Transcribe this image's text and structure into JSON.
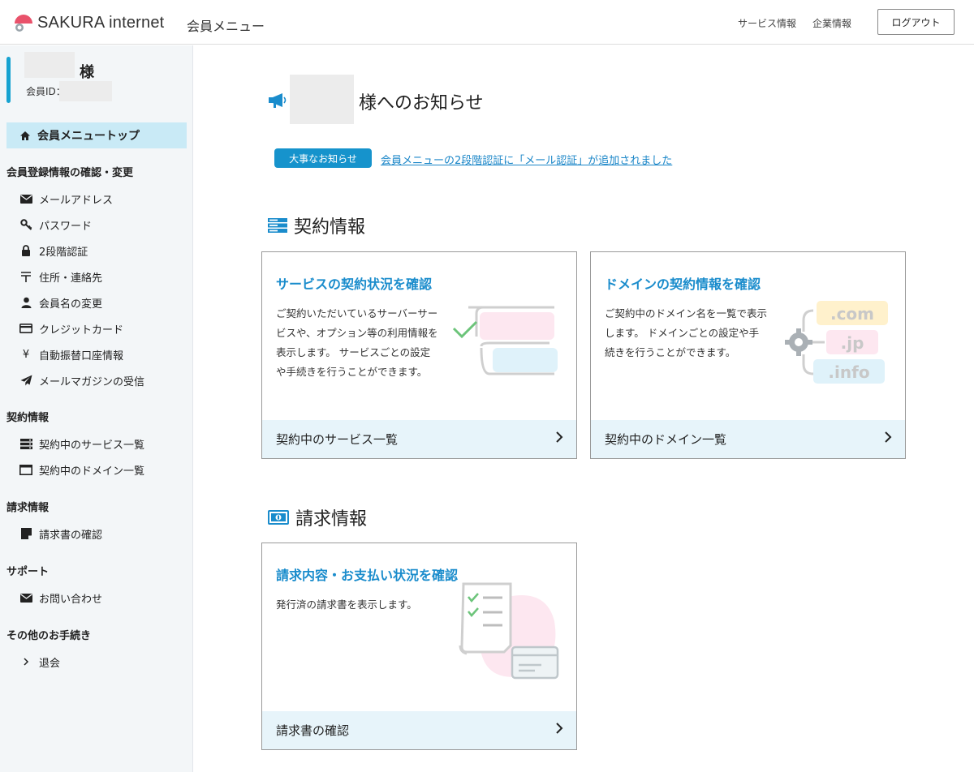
{
  "header": {
    "brand": "SAKURA internet",
    "title": "会員メニュー",
    "links": [
      "サービス情報",
      "企業情報"
    ],
    "logout_label": "ログアウト"
  },
  "sidebar": {
    "user_suffix": "様",
    "member_id_label": "会員ID：",
    "top_item": "会員メニュートップ",
    "sections": [
      {
        "title": "会員登録情報の確認・変更",
        "items": [
          {
            "label": "メールアドレス",
            "icon": "envelope-icon"
          },
          {
            "label": "パスワード",
            "icon": "key-icon"
          },
          {
            "label": "2段階認証",
            "icon": "lock-icon"
          },
          {
            "label": "住所・連絡先",
            "icon": "postal-mark-icon"
          },
          {
            "label": "会員名の変更",
            "icon": "user-icon"
          },
          {
            "label": "クレジットカード",
            "icon": "credit-card-icon"
          },
          {
            "label": "自動振替口座情報",
            "icon": "yen-icon"
          },
          {
            "label": "メールマガジンの受信",
            "icon": "paper-plane-icon"
          }
        ]
      },
      {
        "title": "契約情報",
        "items": [
          {
            "label": "契約中のサービス一覧",
            "icon": "server-icon"
          },
          {
            "label": "契約中のドメイン一覧",
            "icon": "window-icon"
          }
        ]
      },
      {
        "title": "請求情報",
        "items": [
          {
            "label": "請求書の確認",
            "icon": "note-icon"
          }
        ]
      },
      {
        "title": "サポート",
        "items": [
          {
            "label": "お問い合わせ",
            "icon": "envelope-icon"
          }
        ]
      },
      {
        "title": "その他のお手続き",
        "items": [
          {
            "label": "退会",
            "icon": "chevron-right-icon"
          }
        ]
      }
    ]
  },
  "main": {
    "notice_suffix": "様へのお知らせ",
    "badge": "大事なお知らせ",
    "notice_link": "会員メニューの2段階認証に「メール認証」が追加されました",
    "contract_title": "契約情報",
    "billing_title": "請求情報",
    "cards": [
      {
        "title": "サービスの契約状況を確認",
        "desc": "ご契約いただいているサーバーサービスや、オプション等の利用情報を表示します。 サービスごとの設定や手続きを行うことができます。",
        "footer": "契約中のサービス一覧"
      },
      {
        "title": "ドメインの契約情報を確認",
        "desc": "ご契約中のドメイン名を一覧で表示します。 ドメインごとの設定や手続きを行うことができます。",
        "footer": "契約中のドメイン一覧",
        "tlds": [
          ".com",
          ".jp",
          ".info"
        ]
      },
      {
        "title": "請求内容・お支払い状況を確認",
        "desc": "発行済の請求書を表示します。",
        "footer": "請求書の確認"
      }
    ]
  },
  "colors": {
    "accent": "#1693cc",
    "link": "#1a86c8",
    "sidebar_bg": "#f3f6f8",
    "active_bg": "#c9eaf6",
    "card_footer_bg": "#e7f4fa",
    "brand_red": "#e9526b"
  }
}
